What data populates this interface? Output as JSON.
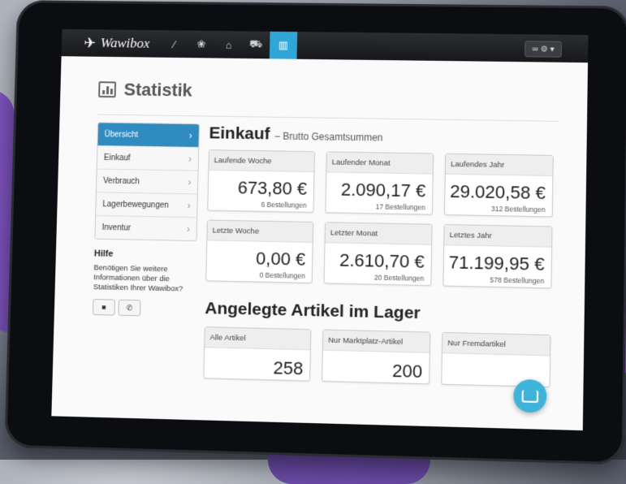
{
  "brand": {
    "name": "Wawibox"
  },
  "navbar": {
    "icons": [
      "wand-icon",
      "gift-icon",
      "inbox-icon",
      "truck-icon",
      "chart-icon"
    ],
    "settings_label": "∞ ⚙ ▾"
  },
  "page": {
    "title": "Statistik"
  },
  "sidebar": {
    "items": [
      {
        "label": "Übersicht"
      },
      {
        "label": "Einkauf"
      },
      {
        "label": "Verbrauch"
      },
      {
        "label": "Lagerbewegungen"
      },
      {
        "label": "Inventur"
      }
    ],
    "help_title": "Hilfe",
    "help_text": "Benötigen Sie weitere Informationen über die Statistiken Ihrer Wawibox?"
  },
  "einkauf": {
    "title": "Einkauf",
    "subtitle": "– Brutto Gesamtsummen",
    "cards": [
      {
        "label": "Laufende Woche",
        "value": "673,80 €",
        "sub": "6 Bestellungen"
      },
      {
        "label": "Laufender Monat",
        "value": "2.090,17 €",
        "sub": "17 Bestellungen"
      },
      {
        "label": "Laufendes Jahr",
        "value": "29.020,58 €",
        "sub": "312 Bestellungen"
      },
      {
        "label": "Letzte Woche",
        "value": "0,00 €",
        "sub": "0 Bestellungen"
      },
      {
        "label": "Letzter Monat",
        "value": "2.610,70 €",
        "sub": "20 Bestellungen"
      },
      {
        "label": "Letztes Jahr",
        "value": "71.199,95 €",
        "sub": "578 Bestellungen"
      }
    ]
  },
  "lager": {
    "title": "Angelegte Artikel im Lager",
    "cards": [
      {
        "label": "Alle Artikel",
        "value": "258"
      },
      {
        "label": "Nur Marktplatz-Artikel",
        "value": "200"
      },
      {
        "label": "Nur Fremdartikel",
        "value": ""
      }
    ]
  },
  "colors": {
    "accent": "#2fa6d6",
    "menu_active": "#2f8bc0",
    "chat": "#3fb3d9"
  }
}
